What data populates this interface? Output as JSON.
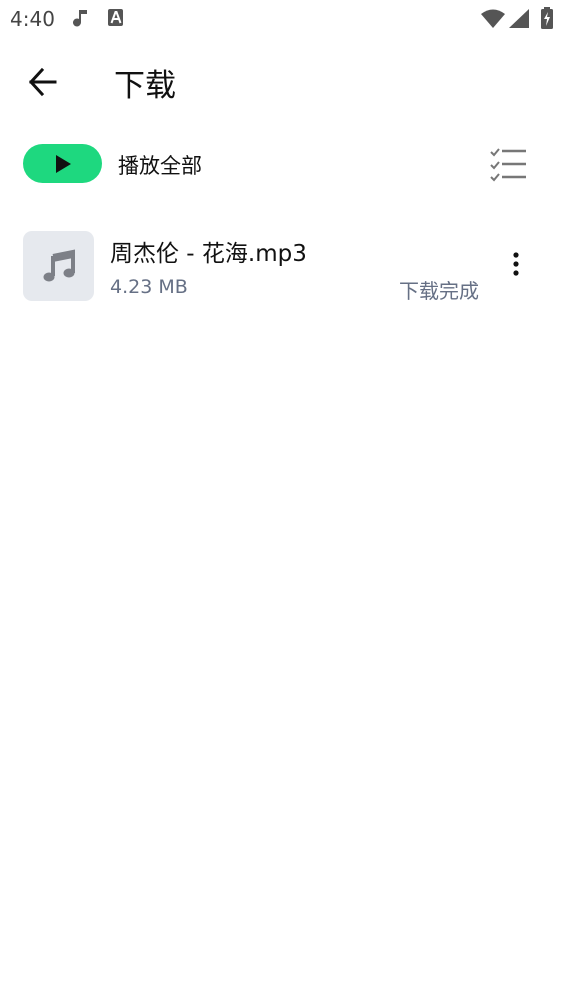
{
  "status_bar": {
    "time": "4:40",
    "icons": [
      "music-note-icon",
      "font-a-icon",
      "wifi-icon",
      "signal-icon",
      "battery-charging-icon"
    ]
  },
  "app_bar": {
    "title": "下载",
    "back_icon": "arrow-left-icon"
  },
  "actions": {
    "play_all_label": "播放全部",
    "play_icon": "play-icon",
    "select_icon": "checklist-icon",
    "accent_color": "#1ED87F"
  },
  "downloads": [
    {
      "title": "周杰伦 - 花海.mp3",
      "size": "4.23 MB",
      "status": "下载完成",
      "thumb_icon": "music-note-icon",
      "more_icon": "more-vertical-icon"
    }
  ]
}
